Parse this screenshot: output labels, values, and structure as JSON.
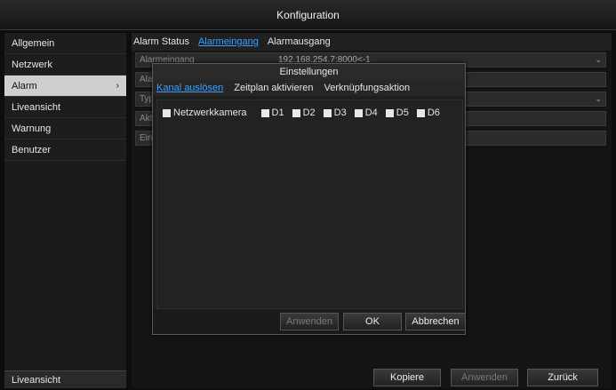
{
  "window": {
    "title": "Konfiguration"
  },
  "sidebar": {
    "items": [
      {
        "label": "Allgemein"
      },
      {
        "label": "Netzwerk"
      },
      {
        "label": "Alarm",
        "chevron": "›"
      },
      {
        "label": "Liveansicht"
      },
      {
        "label": "Warnung"
      },
      {
        "label": "Benutzer"
      }
    ],
    "bottom_label": "Liveansicht"
  },
  "main": {
    "tabs": [
      {
        "label": "Alarm Status"
      },
      {
        "label": "Alarmeingang"
      },
      {
        "label": "Alarmausgang"
      }
    ],
    "rows": [
      {
        "label": "Alarmeingang",
        "value": "192.168.254.7:8000<-1"
      },
      {
        "label": "Alarmname",
        "value": ""
      },
      {
        "label": "Typ",
        "value": ""
      },
      {
        "label": "Aktivieren",
        "value": ""
      },
      {
        "label": "Einstellungen",
        "value": ""
      }
    ],
    "buttons": {
      "copy": "Kopiere",
      "apply": "Anwenden",
      "back": "Zurück"
    }
  },
  "dialog": {
    "title": "Einstellungen",
    "tabs": [
      {
        "label": "Kanal auslösen"
      },
      {
        "label": "Zeitplan aktivieren"
      },
      {
        "label": "Verknüpfungsaktion"
      }
    ],
    "checkboxes": [
      {
        "label": "Netzwerkkamera"
      },
      {
        "label": "D1"
      },
      {
        "label": "D2"
      },
      {
        "label": "D3"
      },
      {
        "label": "D4"
      },
      {
        "label": "D5"
      },
      {
        "label": "D6"
      }
    ],
    "buttons": {
      "apply": "Anwenden",
      "ok": "OK",
      "cancel": "Abbrechen"
    }
  }
}
